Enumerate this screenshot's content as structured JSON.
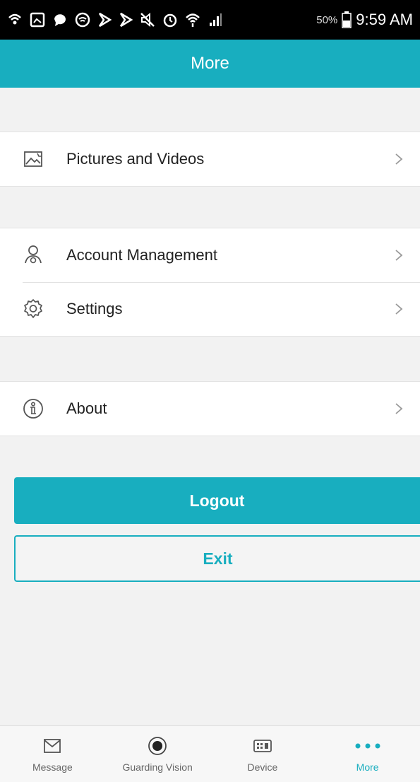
{
  "status_bar": {
    "battery_percent": "50%",
    "time": "9:59 AM"
  },
  "header": {
    "title": "More"
  },
  "menu": {
    "pictures": {
      "label": "Pictures and Videos",
      "icon": "image-icon"
    },
    "account": {
      "label": "Account Management",
      "icon": "user-icon"
    },
    "settings": {
      "label": "Settings",
      "icon": "gear-icon"
    },
    "about": {
      "label": "About",
      "icon": "info-icon"
    }
  },
  "buttons": {
    "logout": "Logout",
    "exit": "Exit"
  },
  "tabbar": {
    "tabs": [
      {
        "label": "Message",
        "icon": "mail-icon"
      },
      {
        "label": "Guarding Vision",
        "icon": "record-icon"
      },
      {
        "label": "Device",
        "icon": "device-icon"
      },
      {
        "label": "More",
        "icon": "more-dots-icon"
      }
    ],
    "active_index": 3
  },
  "colors": {
    "accent": "#18aebf",
    "background": "#f2f2f2",
    "status_bar": "#000000"
  }
}
